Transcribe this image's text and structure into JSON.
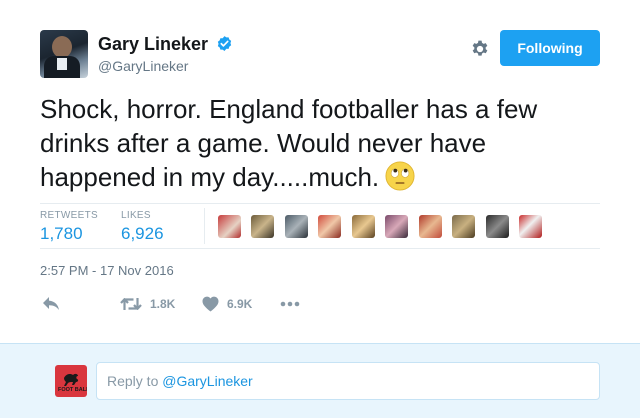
{
  "tweet": {
    "author": {
      "name": "Gary Lineker",
      "handle": "@GaryLineker",
      "verified": true
    },
    "follow_button_label": "Following",
    "text": "Shock, horror. England footballer has a few drinks after a game. Would never have happened in my day.....much.",
    "emoji": "face-with-rolling-eyes",
    "stats": {
      "retweets_label": "RETWEETS",
      "retweets_value": "1,780",
      "likes_label": "LIKES",
      "likes_value": "6,926"
    },
    "likers_count": 10,
    "timestamp": "2:57 PM - 17 Nov 2016",
    "actions": {
      "reply_icon": "reply-icon",
      "retweet_count": "1.8K",
      "like_count": "6.9K",
      "more_icon": "more-icon"
    }
  },
  "reply": {
    "prefix": "Reply to ",
    "handle": "@GaryLineker"
  },
  "colors": {
    "accent": "#1da1f2",
    "link": "#1b95e0",
    "muted": "#657786",
    "reply_bg": "#e8f5fd",
    "emoji_yellow": "#f7d44a"
  }
}
